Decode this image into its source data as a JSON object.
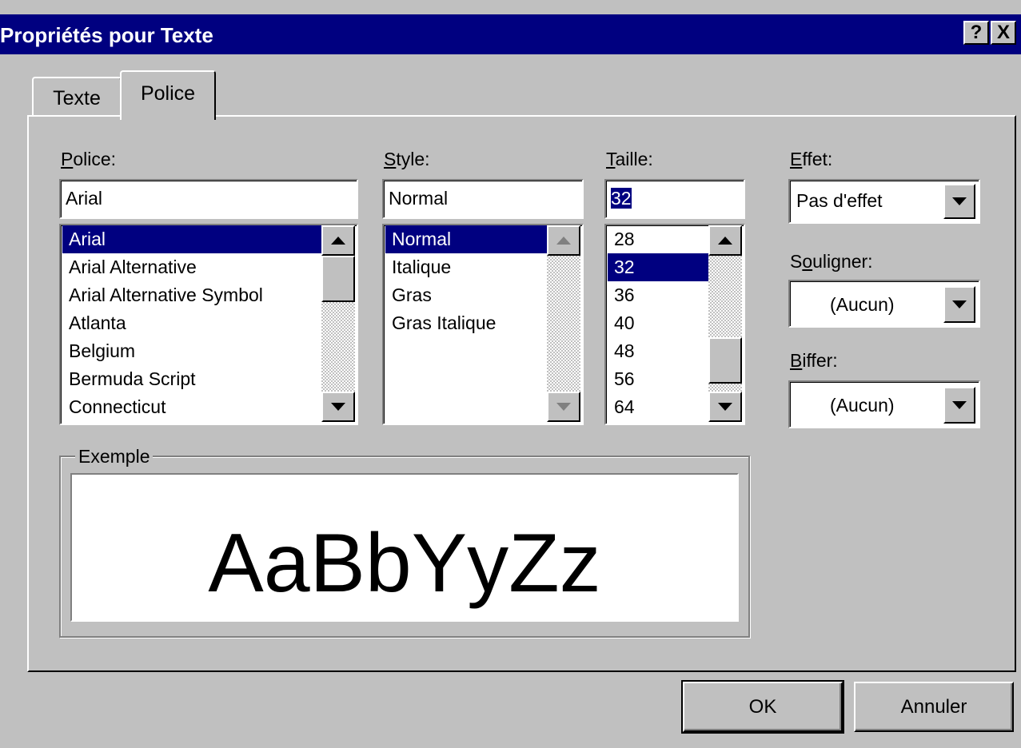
{
  "window": {
    "title": "Propriétés pour Texte",
    "help_button": "?",
    "close_button": "X",
    "title_bar_color": "#000080"
  },
  "tabs": [
    {
      "label": "Texte",
      "active": false
    },
    {
      "label": "Police",
      "active": true
    }
  ],
  "font": {
    "label_key": "P",
    "label_rest": "olice:",
    "value": "Arial",
    "items": [
      "Arial",
      "Arial Alternative",
      "Arial Alternative Symbol",
      "Atlanta",
      "Belgium",
      "Bermuda Script",
      "Connecticut"
    ],
    "selected": "Arial"
  },
  "style": {
    "label_key": "S",
    "label_rest": "tyle:",
    "value": "Normal",
    "items": [
      "Normal",
      "Italique",
      "Gras",
      "Gras Italique"
    ],
    "selected": "Normal"
  },
  "size": {
    "label_key": "T",
    "label_rest": "aille:",
    "value": "32",
    "items": [
      "28",
      "32",
      "36",
      "40",
      "48",
      "56",
      "64"
    ],
    "selected": "32"
  },
  "effect": {
    "label_key": "E",
    "label_rest": "ffet:",
    "value": "Pas d'effet"
  },
  "underline": {
    "label_pre": "S",
    "label_key": "o",
    "label_rest": "uligner:",
    "value": "(Aucun)"
  },
  "strike": {
    "label_key": "B",
    "label_rest": "iffer:",
    "value": "(Aucun)"
  },
  "sample": {
    "legend": "Exemple",
    "text": "AaBbYyZz"
  },
  "buttons": {
    "ok": "OK",
    "cancel": "Annuler"
  }
}
